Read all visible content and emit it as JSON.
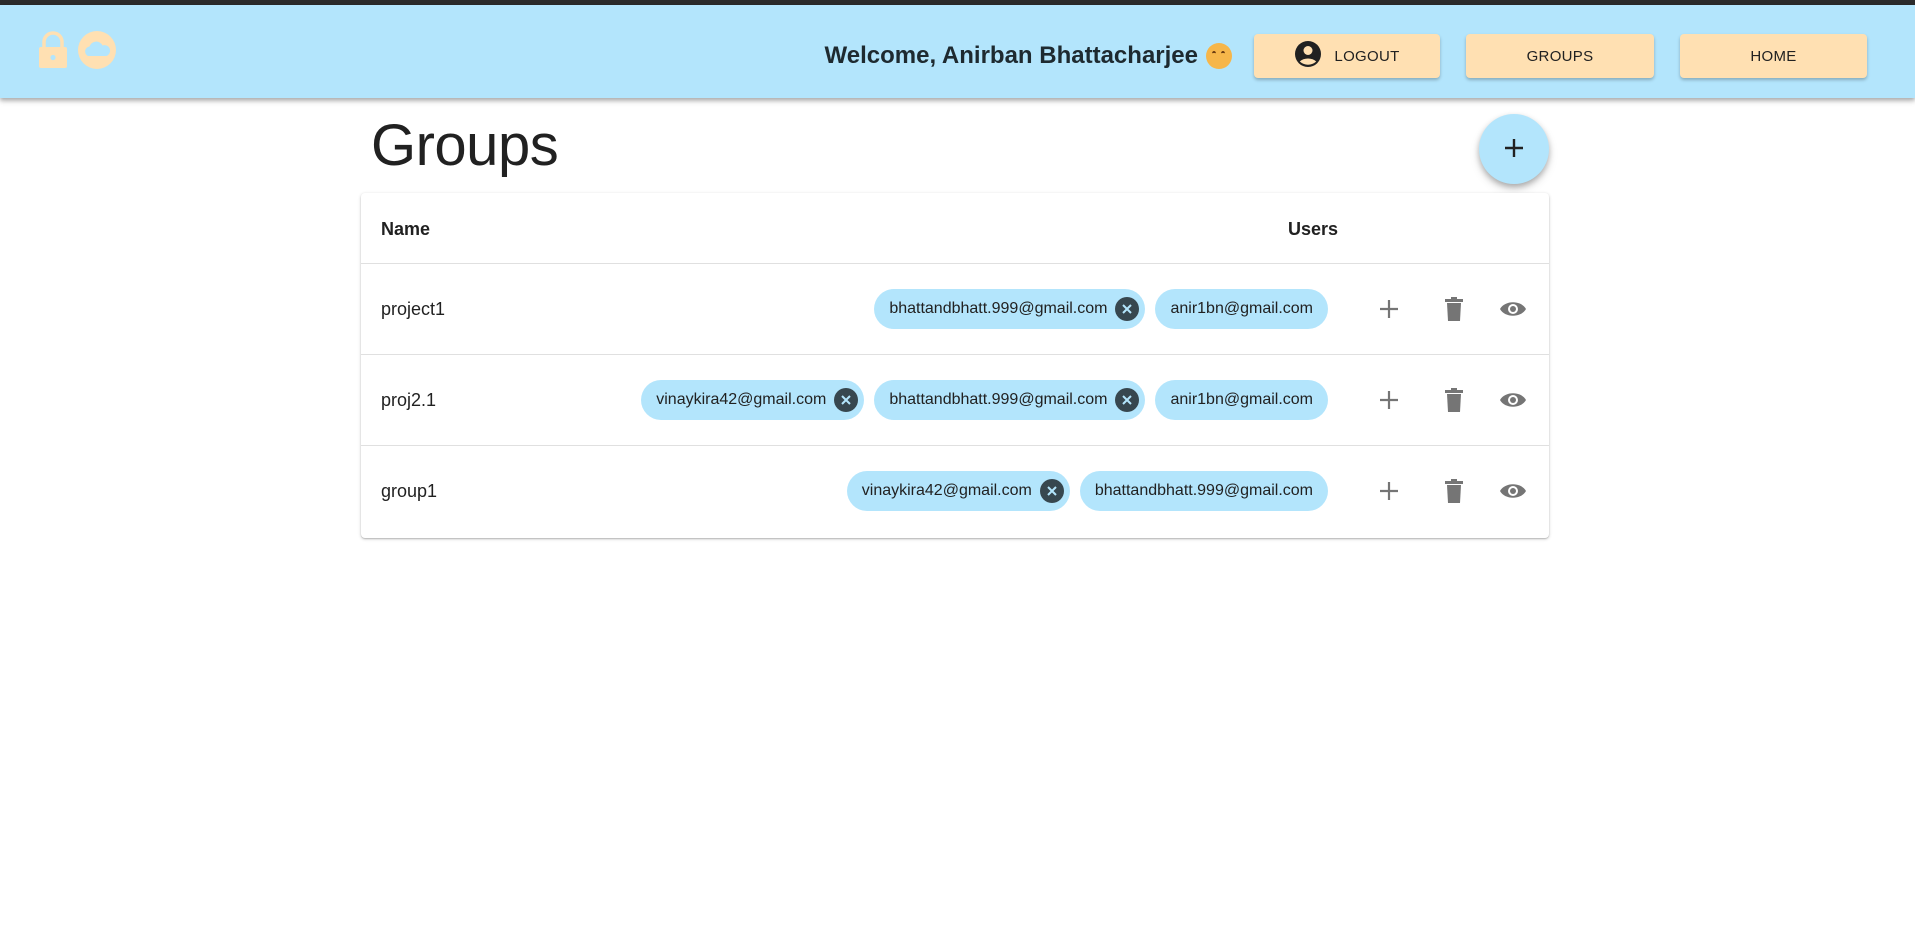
{
  "header": {
    "welcome_text": "Welcome, Anirban Bhattacharjee",
    "emoji_icon": "hugging-face-emoji",
    "nav": {
      "logout": "LOGOUT",
      "groups": "GROUPS",
      "home": "HOME"
    },
    "colors": {
      "appbar": "#b3e5fc",
      "nav_button": "#ffe0b2",
      "logo": "#ffe0b2"
    },
    "logo_icons": [
      "lock-icon",
      "cloud-icon"
    ]
  },
  "page": {
    "title": "Groups",
    "fab_icon": "plus-icon"
  },
  "table": {
    "columns": {
      "name": "Name",
      "users": "Users"
    },
    "rows": [
      {
        "name": "project1",
        "users": [
          {
            "email": "bhattandbhatt.999@gmail.com",
            "removable": true
          },
          {
            "email": "anir1bn@gmail.com",
            "removable": false
          }
        ]
      },
      {
        "name": "proj2.1",
        "users": [
          {
            "email": "vinaykira42@gmail.com",
            "removable": true
          },
          {
            "email": "bhattandbhatt.999@gmail.com",
            "removable": true
          },
          {
            "email": "anir1bn@gmail.com",
            "removable": false
          }
        ]
      },
      {
        "name": "group1",
        "users": [
          {
            "email": "vinaykira42@gmail.com",
            "removable": true
          },
          {
            "email": "bhattandbhatt.999@gmail.com",
            "removable": false
          }
        ]
      }
    ],
    "row_actions": [
      "plus-icon",
      "trash-icon",
      "eye-icon"
    ]
  }
}
